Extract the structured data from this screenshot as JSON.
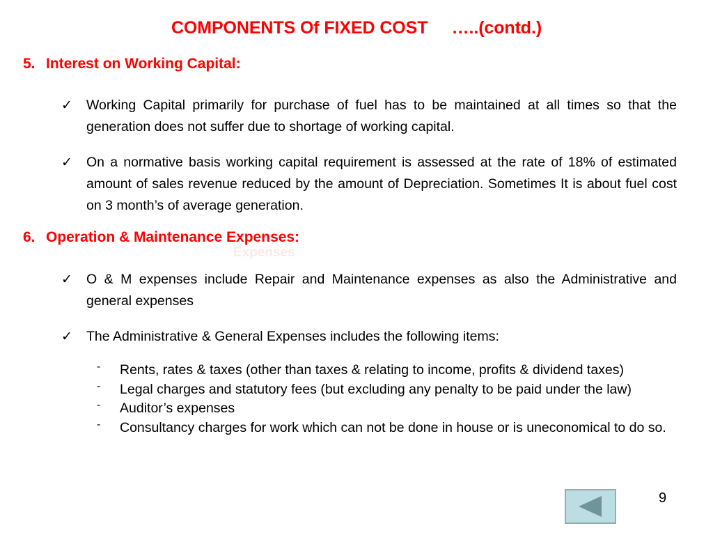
{
  "slide": {
    "title": "COMPONENTS Of FIXED COST     …..(contd.)",
    "page_number": "9",
    "accent_color": "#ff0000",
    "text_color": "#000000",
    "background_color": "#ffffff"
  },
  "sections": [
    {
      "number": "5.",
      "heading": "Interest on Working Capital:",
      "bullets": [
        {
          "marker": "✓",
          "text": "Working Capital primarily for purchase of fuel has to be maintained at all times so that the generation does not suffer due to shortage of working capital."
        },
        {
          "marker": "✓",
          "text": "On a normative basis working capital requirement is assessed at the rate of 18% of estimated amount of sales revenue reduced by the amount of Depreciation. Sometimes  It is about fuel cost on 3 month’s of average generation."
        }
      ]
    },
    {
      "number": "6.",
      "heading": "Operation & Maintenance Expenses:",
      "bullets": [
        {
          "marker": "✓",
          "text": "O & M expenses include Repair and Maintenance expenses as also the Administrative and general expenses"
        },
        {
          "marker": "✓",
          "text": "The Administrative & General Expenses includes the following items:"
        }
      ],
      "sub_items": [
        {
          "marker": "-",
          "text": "Rents, rates & taxes (other than taxes & relating to income, profits & dividend taxes)"
        },
        {
          "marker": "-",
          "text": "Legal charges and statutory fees (but excluding any penalty to be paid under the law)"
        },
        {
          "marker": "-",
          "text": "Auditor’s expenses"
        },
        {
          "marker": "-",
          "text": "Consultancy charges for work which can not be done in house or is uneconomical to do so."
        }
      ]
    }
  ],
  "nav": {
    "back_button_icon": "triangle-left-icon",
    "back_button_fill": "#bcdde1",
    "back_button_border": "#93adb1",
    "back_button_arrow_color": "#6f9499"
  },
  "artifact": {
    "ghost_text": "Expenses"
  }
}
